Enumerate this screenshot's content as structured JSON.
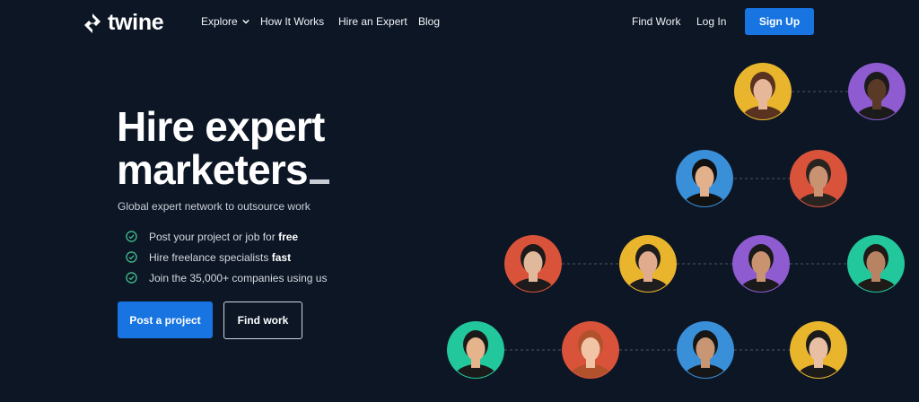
{
  "nav": {
    "logo_text": "twine",
    "explore_label": "Explore",
    "how_it_works_label": "How It Works",
    "hire_expert_label": "Hire an Expert",
    "blog_label": "Blog",
    "find_work_label": "Find Work",
    "login_label": "Log In",
    "signup_label": "Sign Up"
  },
  "hero": {
    "title_line1": "Hire expert",
    "title_line2": "marketers",
    "subtitle": "Global expert network to outsource work",
    "features": [
      {
        "text": "Post your project or job for ",
        "bold": "free"
      },
      {
        "text": "Hire freelance  specialists ",
        "bold": "fast"
      },
      {
        "text": "Join the 35,000+ companies using us",
        "bold": ""
      }
    ],
    "primary_button": "Post a project",
    "secondary_button": "Find work"
  },
  "colors": {
    "background": "#0d1625",
    "accent": "#1774e0",
    "check": "#3fbf8f"
  },
  "avatars": [
    {
      "name": "freelancer-1",
      "bg": "#e9b52c",
      "skin": "#e7b79a",
      "hair": "#5a3320"
    },
    {
      "name": "freelancer-2",
      "bg": "#8e5bd1",
      "skin": "#5a3a27",
      "hair": "#1b1b1b"
    },
    {
      "name": "freelancer-3",
      "bg": "#3a8fd9",
      "skin": "#e3b08c",
      "hair": "#111111"
    },
    {
      "name": "freelancer-4",
      "bg": "#d9533a",
      "skin": "#c99372",
      "hair": "#2a2420"
    },
    {
      "name": "freelancer-5",
      "bg": "#d9533a",
      "skin": "#e0b89c",
      "hair": "#1c1a1a"
    },
    {
      "name": "freelancer-6",
      "bg": "#e9b52c",
      "skin": "#e1ab8e",
      "hair": "#1d1d1d"
    },
    {
      "name": "freelancer-7",
      "bg": "#8e5bd1",
      "skin": "#c99270",
      "hair": "#1a1a1a"
    },
    {
      "name": "freelancer-8",
      "bg": "#22c79c",
      "skin": "#b78363",
      "hair": "#1e1a17"
    },
    {
      "name": "freelancer-9",
      "bg": "#22c79c",
      "skin": "#e5b38c",
      "hair": "#1a1a1a"
    },
    {
      "name": "freelancer-10",
      "bg": "#d9533a",
      "skin": "#f0c4a5",
      "hair": "#b1522c"
    },
    {
      "name": "freelancer-11",
      "bg": "#3a8fd9",
      "skin": "#c99673",
      "hair": "#161616"
    },
    {
      "name": "freelancer-12",
      "bg": "#e9b52c",
      "skin": "#e9bfa4",
      "hair": "#1b1b1b"
    }
  ]
}
